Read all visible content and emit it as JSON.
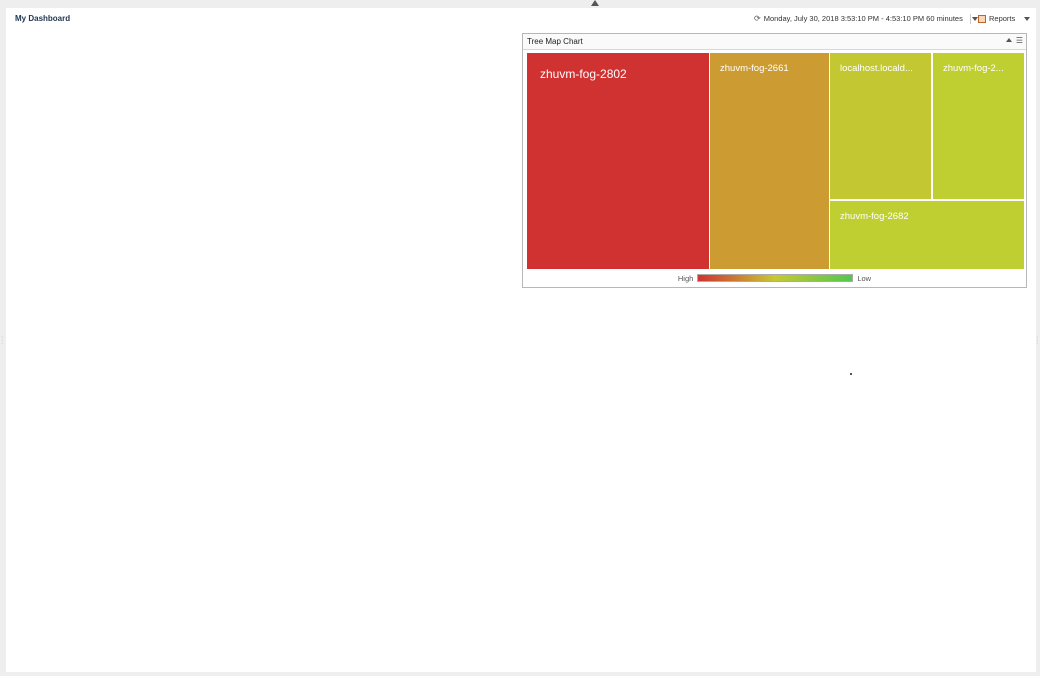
{
  "header": {
    "title": "My Dashboard",
    "time_range": "Monday, July 30, 2018 3:53:10 PM - 4:53:10 PM 60 minutes",
    "reports_label": "Reports"
  },
  "widget": {
    "title": "Tree Map Chart",
    "legend": {
      "high_label": "High",
      "low_label": "Low",
      "high_color": "#d03232",
      "mid_color": "#c8c832",
      "low_color": "#50c850"
    }
  },
  "chart_data": {
    "type": "treemap",
    "items": [
      {
        "label": "zhuvm-fog-2802",
        "color": "#d03232"
      },
      {
        "label": "zhuvm-fog-2661",
        "color": "#cc9c32"
      },
      {
        "label": "localhost.locald...",
        "color": "#c3c832"
      },
      {
        "label": "zhuvm-fog-2...",
        "color": "#bfcf32"
      },
      {
        "label": "zhuvm-fog-2682",
        "color": "#bfcf32"
      }
    ]
  }
}
